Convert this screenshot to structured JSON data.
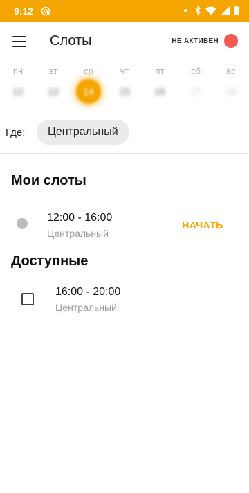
{
  "status_bar": {
    "time": "9:12"
  },
  "header": {
    "title": "Слоты",
    "status_text": "НЕ АКТИВЕН",
    "status_color": "#f25b54"
  },
  "week": {
    "days": [
      {
        "name": "пн",
        "num": "12"
      },
      {
        "name": "вт",
        "num": "13"
      },
      {
        "name": "ср",
        "num": "14",
        "selected": true
      },
      {
        "name": "чт",
        "num": "15"
      },
      {
        "name": "пт",
        "num": "16"
      },
      {
        "name": "сб",
        "num": "17"
      },
      {
        "name": "вс",
        "num": "18"
      }
    ]
  },
  "where": {
    "label": "Где:",
    "value": "Центральный"
  },
  "my_slots": {
    "title": "Мои слоты",
    "items": [
      {
        "time": "12:00 - 16:00",
        "place": "Центральный",
        "action": "НАЧАТЬ"
      }
    ]
  },
  "available": {
    "title": "Доступные",
    "items": [
      {
        "time": "16:00 - 20:00",
        "place": "Центральный"
      }
    ]
  },
  "colors": {
    "accent": "#f5a500",
    "inactive": "#f25b54"
  }
}
